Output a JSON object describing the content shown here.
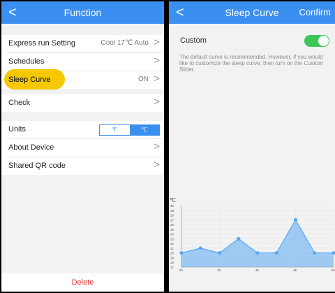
{
  "left": {
    "back_icon": "chevron-left-icon",
    "title": "Function",
    "express": {
      "label": "Express run Setting",
      "value": "Cool 17℃ Auto"
    },
    "schedules": {
      "label": "Schedules"
    },
    "sleep": {
      "label": "Sleep Curve",
      "value": "ON"
    },
    "check": {
      "label": "Check"
    },
    "units": {
      "label": "Units",
      "f": "℉",
      "c": "℃",
      "selected": "℃"
    },
    "about": {
      "label": "About Device"
    },
    "shared": {
      "label": "Shared QR code"
    },
    "delete_label": "Delete",
    "accent": "#3b8ff0",
    "highlight_color": "#f5c800",
    "delete_color": "#e53935"
  },
  "right": {
    "back_icon": "chevron-left-icon",
    "title": "Sleep Curve",
    "confirm": "Confirm",
    "custom": {
      "label": "Custom",
      "enabled": true
    },
    "description": "The default curve is recommended. However, if you would like to customize the sleep curve, then turn on the Custom Slider.",
    "toggle_color": "#3dc75a"
  },
  "chart_data": {
    "type": "area",
    "ylabel": "℃",
    "ylim": [
      17,
      30
    ],
    "y_ticks": [
      "30",
      "29",
      "28",
      "27",
      "26",
      "25",
      "24",
      "23",
      "22",
      "21",
      "20",
      "19",
      "18",
      "17"
    ],
    "x_ticks": [
      "0h",
      "2h",
      "4h",
      "6h",
      "8h"
    ],
    "x": [
      0,
      1,
      2,
      3,
      4,
      5,
      6,
      7,
      8
    ],
    "values": [
      20,
      21,
      20,
      23,
      20,
      20,
      27,
      20,
      20
    ],
    "color": "#5aa9f5",
    "grid": true
  }
}
